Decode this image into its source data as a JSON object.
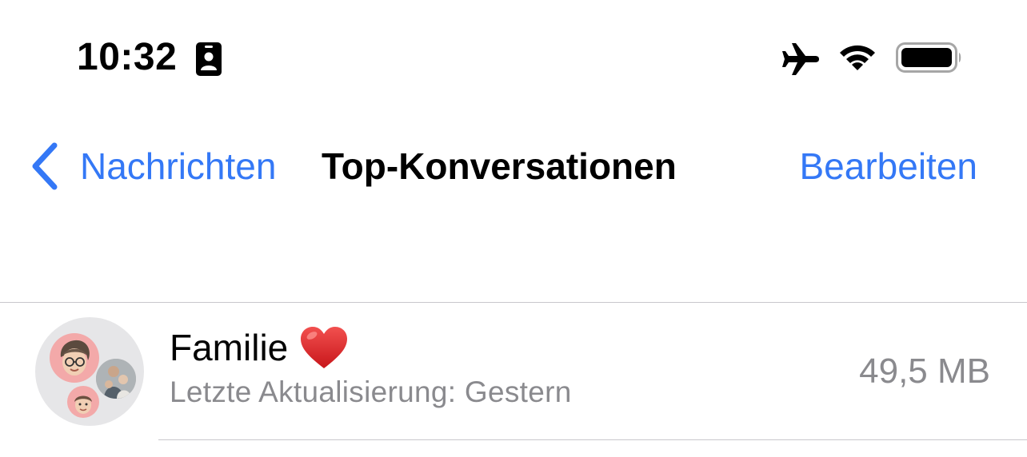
{
  "status_bar": {
    "time": "10:32",
    "icons": [
      "id-card-icon",
      "airplane-icon",
      "wifi-icon",
      "battery-icon"
    ]
  },
  "nav": {
    "back_label": "Nachrichten",
    "title": "Top-Konversationen",
    "edit_label": "Bearbeiten"
  },
  "conversations": [
    {
      "name": "Familie",
      "emoji": "heart-icon",
      "subtitle": "Letzte Aktualisierung: Gestern",
      "size": "49,5 MB"
    }
  ],
  "colors": {
    "accent": "#3478f6",
    "secondary_text": "#8a8a8e",
    "separator": "#c8c7cc",
    "heart": "#e0262a"
  }
}
